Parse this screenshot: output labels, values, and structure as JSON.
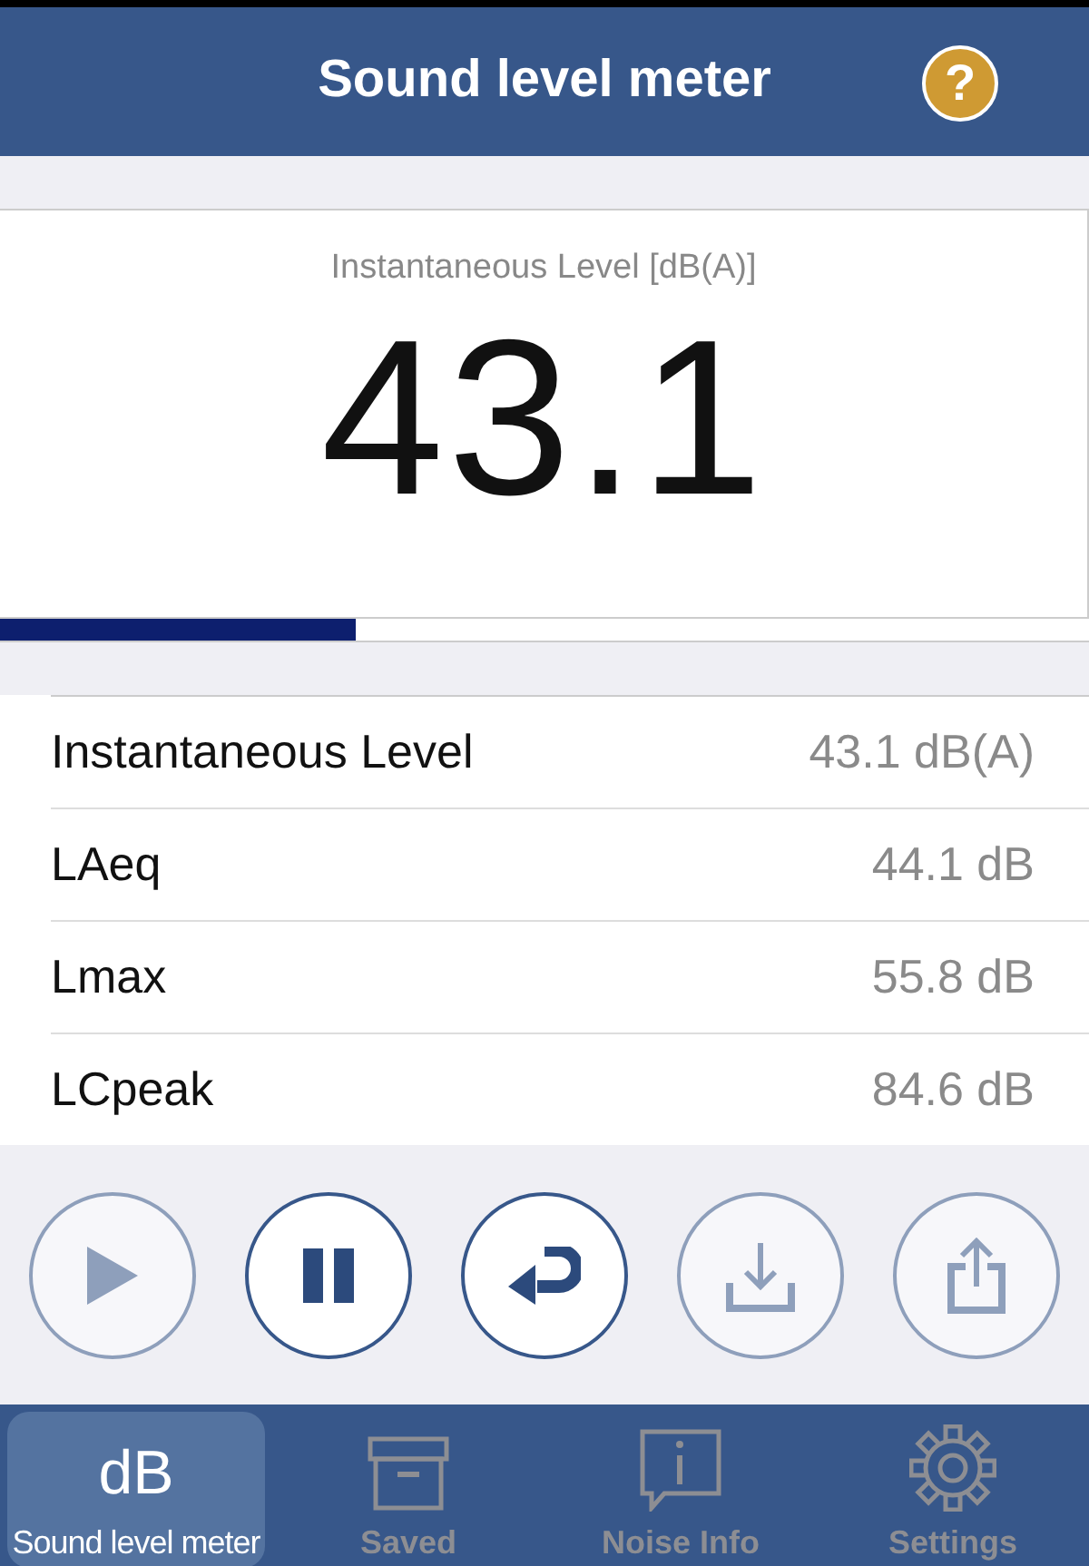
{
  "header": {
    "title": "Sound level meter",
    "help": "?"
  },
  "display": {
    "label": "Instantaneous Level [dB(A)]",
    "value": "43.1",
    "level": 0.327
  },
  "measurements": [
    {
      "name": "Instantaneous Level",
      "value": "43.1 dB(A)"
    },
    {
      "name": "LAeq",
      "value": "44.1 dB"
    },
    {
      "name": "Lmax",
      "value": "55.8 dB"
    },
    {
      "name": "LCpeak",
      "value": "84.6 dB"
    }
  ],
  "controls": [
    {
      "kind": "play",
      "disabled": true
    },
    {
      "kind": "pause",
      "disabled": false
    },
    {
      "kind": "reset",
      "disabled": false
    },
    {
      "kind": "download",
      "disabled": true
    },
    {
      "kind": "share",
      "disabled": true
    }
  ],
  "tabs": [
    {
      "kind": "text",
      "glyph": "dB",
      "label": "Sound level meter",
      "selected": true
    },
    {
      "kind": "box",
      "label": "Saved",
      "selected": false
    },
    {
      "kind": "info",
      "label": "Noise Info",
      "selected": false
    },
    {
      "kind": "gear",
      "label": "Settings",
      "selected": false
    }
  ]
}
